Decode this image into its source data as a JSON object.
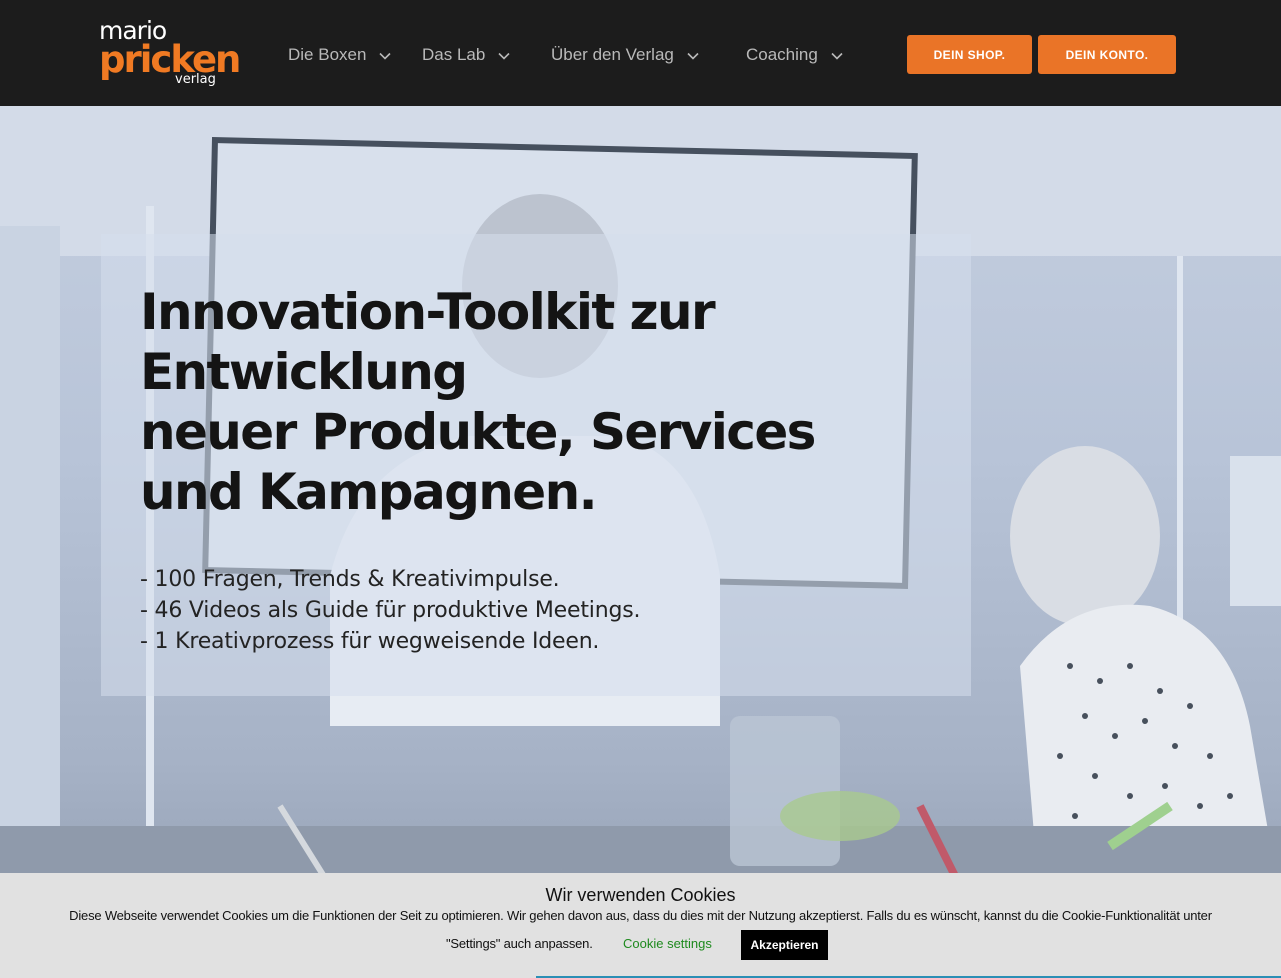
{
  "logo": {
    "line1": "mario",
    "line2": "pricken",
    "line3": "verlag"
  },
  "nav": {
    "items": [
      {
        "label": "Die Boxen"
      },
      {
        "label": "Das Lab"
      },
      {
        "label": "Über den Verlag"
      },
      {
        "label": "Coaching"
      }
    ],
    "shop_button": "DEIN SHOP.",
    "account_button": "DEIN KONTO."
  },
  "hero": {
    "title_lines": [
      "Innovation-Toolkit zur Entwicklung",
      "neuer Produkte, Services",
      "und Kampagnen."
    ],
    "bullets": [
      "- 100 Fragen, Trends & Kreativimpulse.",
      "- 46 Videos als Guide für produktive Meetings.",
      "- 1 Kreativprozess für wegweisende Ideen."
    ]
  },
  "cookie": {
    "title": "Wir verwenden Cookies",
    "text": "Diese Webseite verwendet Cookies um die Funktionen der Seit zu optimieren. Wir gehen davon aus, dass du dies mit der Nutzung akzeptierst. Falls du es wünscht, kannst du die Cookie-Funktionalität unter",
    "text2": "\"Settings\" auch anpassen.",
    "settings_link": "Cookie settings",
    "accept_button": "Akzeptieren"
  },
  "colors": {
    "accent": "#ea7427",
    "header_bg": "#1c1c1c",
    "cookie_link": "#1e8a1e"
  }
}
